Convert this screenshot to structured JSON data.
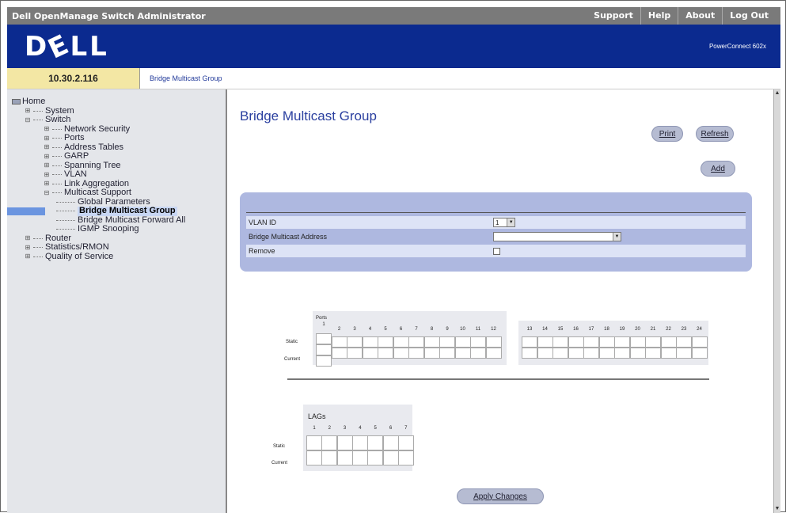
{
  "app_title": "Dell OpenManage Switch Administrator",
  "top_links": [
    "Support",
    "Help",
    "About",
    "Log Out"
  ],
  "brand": {
    "logo": "DƐLL",
    "model": "PowerConnect 602x"
  },
  "address": {
    "ip": "10.30.2.116",
    "breadcrumb": "Bridge Multicast Group"
  },
  "tree": [
    {
      "label": "Home",
      "depth": 0,
      "icon": "folder-icon"
    },
    {
      "label": "System",
      "depth": 1,
      "expander": "+"
    },
    {
      "label": "Switch",
      "depth": 1,
      "expander": "-"
    },
    {
      "label": "Network Security",
      "depth": 2,
      "expander": "+"
    },
    {
      "label": "Ports",
      "depth": 2,
      "expander": "+"
    },
    {
      "label": "Address Tables",
      "depth": 2,
      "expander": "+"
    },
    {
      "label": "GARP",
      "depth": 2,
      "expander": "+"
    },
    {
      "label": "Spanning Tree",
      "depth": 2,
      "expander": "+"
    },
    {
      "label": "VLAN",
      "depth": 2,
      "expander": "+"
    },
    {
      "label": "Link Aggregation",
      "depth": 2,
      "expander": "+"
    },
    {
      "label": "Multicast Support",
      "depth": 2,
      "expander": "-"
    },
    {
      "label": "Global Parameters",
      "depth": 3
    },
    {
      "label": "Bridge Multicast Group",
      "depth": 3,
      "selected": true
    },
    {
      "label": "Bridge Multicast Forward All",
      "depth": 3
    },
    {
      "label": "IGMP Snooping",
      "depth": 3
    },
    {
      "label": "Router",
      "depth": 1,
      "expander": "+"
    },
    {
      "label": "Statistics/RMON",
      "depth": 1,
      "expander": "+"
    },
    {
      "label": "Quality of Service",
      "depth": 1,
      "expander": "+"
    }
  ],
  "main": {
    "title": "Bridge Multicast Group",
    "print_label": "Print",
    "refresh_label": "Refresh",
    "add_label": "Add",
    "apply_label": "Apply Changes"
  },
  "form": {
    "vlan_label": "VLAN ID",
    "vlan_value": "1",
    "multicast_label": "Bridge Multicast Address",
    "multicast_value": "",
    "remove_label": "Remove"
  },
  "ports": {
    "heading": "Ports",
    "static_label": "Static",
    "current_label": "Current",
    "group1": [
      "1",
      "2",
      "3",
      "4",
      "5",
      "6",
      "7",
      "8",
      "9",
      "10",
      "11",
      "12"
    ],
    "group2": [
      "13",
      "14",
      "15",
      "16",
      "17",
      "18",
      "19",
      "20",
      "21",
      "22",
      "23",
      "24"
    ]
  },
  "lags": {
    "heading": "LAGs",
    "static_label": "Static",
    "current_label": "Current",
    "numbers": [
      "1",
      "2",
      "3",
      "4",
      "5",
      "6",
      "7"
    ]
  }
}
